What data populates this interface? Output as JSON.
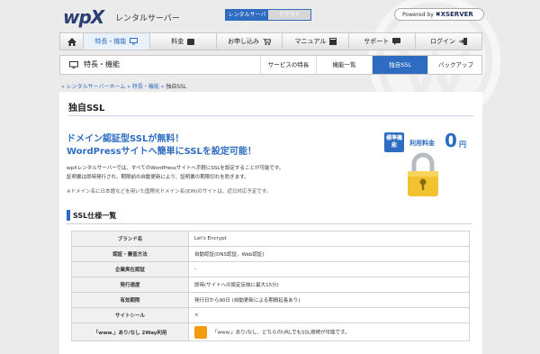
{
  "header": {
    "logo": "wpX",
    "logo_sub": "レンタルサーバー",
    "switch_active": "レンタルサーバー",
    "switch_inactive": "クラウド",
    "powered_by": "Powered by",
    "powered_brand": "XSERVER"
  },
  "nav": {
    "items": [
      {
        "label": "特長・機能"
      },
      {
        "label": "料金"
      },
      {
        "label": "お申し込み"
      },
      {
        "label": "マニュアル"
      },
      {
        "label": "サポート"
      },
      {
        "label": "ログイン"
      }
    ]
  },
  "subbar": {
    "title": "特長・機能",
    "tabs": [
      "サービスの特長",
      "機能一覧",
      "独自SSL",
      "バックアップ"
    ]
  },
  "breadcrumb": {
    "home": "レンタルサーバーホーム",
    "parent": "特長・機能",
    "current": "独自SSL"
  },
  "page": {
    "title": "独自SSL",
    "headline1": "ドメイン認証型SSLが無料！",
    "headline2": "WordPressサイトへ簡単にSSLを設定可能！",
    "desc1": "wpXレンタルサーバーでは、すべてのWordPressサイトへ手軽にSSLを設定することが可能です。",
    "desc2": "証明書は即時発行され、期限前の自動更新により、証明書の期限切れを防ぎます。",
    "note": "※ドメイン名に日本語などを用いた国際化ドメイン名(IDN)のサイトは、近日対応予定です。",
    "badge": "標準機能",
    "price_label": "利用料金",
    "price_value": "0",
    "price_unit": "円"
  },
  "spec": {
    "title": "SSL仕様一覧",
    "rows": [
      {
        "label": "ブランド名",
        "value": "Let's Encrypt"
      },
      {
        "label": "認証・審査方法",
        "value": "自動認証(DNS認証、Web認証)"
      },
      {
        "label": "企業実在認証",
        "value": "-"
      },
      {
        "label": "発行速度",
        "value": "即時(サイトへの設定反映に最大15分)"
      },
      {
        "label": "有効期限",
        "value": "発行日から90日 (自動更新による期間延長あり)"
      },
      {
        "label": "サイトシール",
        "value": "×"
      },
      {
        "label": "「www.」あり/なし 2Way利用",
        "value": "「www.」あり/なし、どちらのURLでもSSL接続が可能です。"
      }
    ]
  },
  "colors": {
    "accent": "#2d6cc0",
    "background": "#ebebeb"
  }
}
